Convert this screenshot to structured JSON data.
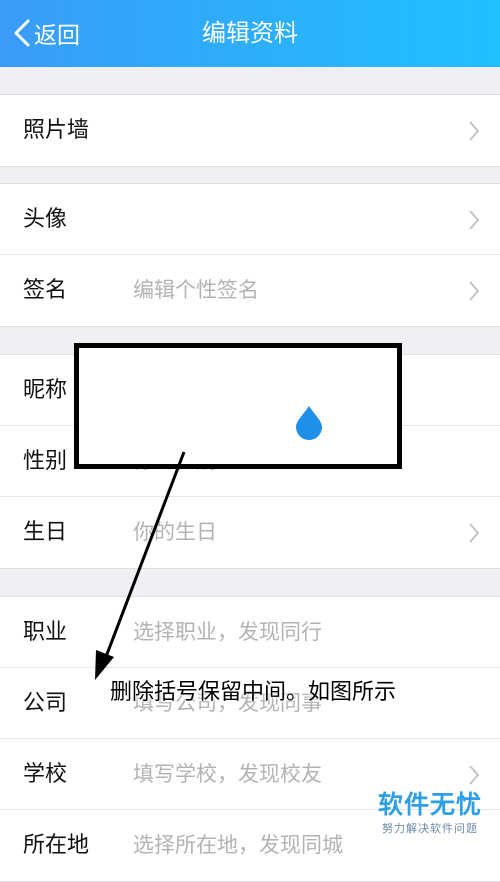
{
  "header": {
    "back_label": "返回",
    "title": "编辑资料"
  },
  "sections": [
    [
      {
        "label": "照片墙",
        "value": ""
      }
    ],
    [
      {
        "label": "头像",
        "value": ""
      },
      {
        "label": "签名",
        "value": "编辑个性签名"
      }
    ],
    [
      {
        "label": "昵称",
        "value": ""
      },
      {
        "label": "性别",
        "value": "你的性别"
      },
      {
        "label": "生日",
        "value": "你的生日"
      }
    ],
    [
      {
        "label": "职业",
        "value": "选择职业，发现同行"
      },
      {
        "label": "公司",
        "value": "填写公司，发现同事"
      },
      {
        "label": "学校",
        "value": "填写学校，发现校友"
      },
      {
        "label": "所在地",
        "value": "选择所在地，发现同城"
      }
    ]
  ],
  "annotation": {
    "text": "删除括号保留中间。如图所示"
  },
  "watermark": {
    "main": "软件无忧",
    "sub": "努力解决软件问题"
  },
  "colors": {
    "header_start": "#3a9cf7",
    "header_end": "#20c0ff",
    "accent": "#2196f3"
  }
}
